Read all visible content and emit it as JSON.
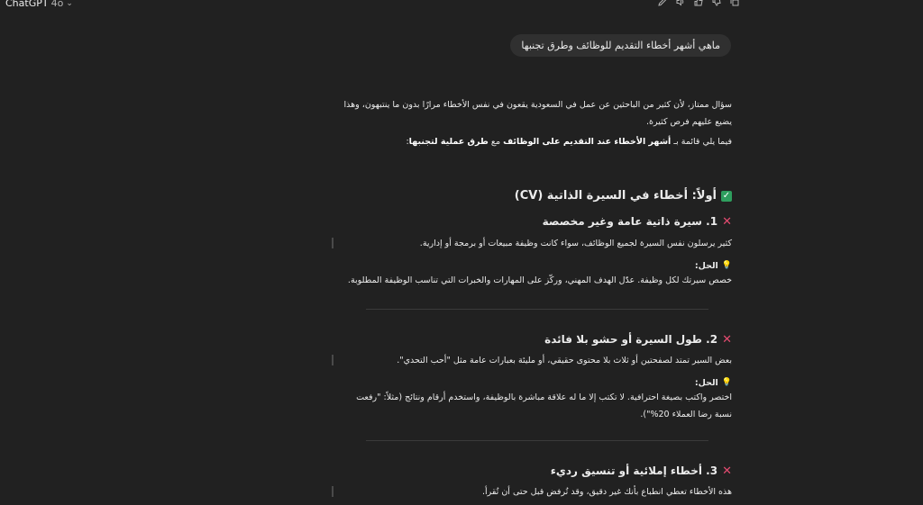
{
  "app": {
    "name": "ChatGPT",
    "model_version": "4o"
  },
  "toolbar_icons": [
    "edit-icon",
    "speaker-icon",
    "thumbs-up-icon",
    "thumbs-down-icon",
    "copy-icon"
  ],
  "user_message": "ماهي  أشهر أخطاء التقديم للوظائف  وطرق تجنبها",
  "answer": {
    "intro": "سؤال ممتاز، لأن كثير من الباحثين عن عمل في السعودية يقعون في نفس الأخطاء مرارًا بدون ما ينتبهون، وهذا يضيع عليهم فرص كثيرة.",
    "list_intro_pre": "فيما يلي قائمة بـ ",
    "list_intro_bold1": "أشهر الأخطاء عند التقديم على الوظائف",
    "list_intro_mid": " مع ",
    "list_intro_bold2": "طرق عملية لتجنبها",
    "list_intro_end": ":",
    "section_title": "أولاً: أخطاء في السيرة الذاتية (CV)",
    "solution_label": "الحل:",
    "items": [
      {
        "title": "1. سيرة ذاتية عامة وغير مخصصة",
        "problem": "كثير يرسلون نفس السيرة لجميع الوظائف، سواء كانت وظيفة مبيعات أو برمجة أو إدارية.",
        "solution": "خصص سيرتك لكل وظيفة. عدّل الهدف المهني، وركّز على المهارات والخبرات التي تناسب الوظيفة المطلوبة."
      },
      {
        "title": "2. طول السيرة أو حشو بلا فائدة",
        "problem": "بعض السير تمتد لصفحتين أو ثلاث بلا محتوى حقيقي، أو مليئة بعبارات عامة مثل \"أحب التحدي\".",
        "solution": "اختصر واكتب بصيغة احترافية. لا تكتب إلا ما له علاقة مباشرة بالوظيفة، واستخدم أرقام ونتائج (مثلاً: \"رفعت نسبة رضا العملاء 20%\")."
      },
      {
        "title": "3. أخطاء إملائية أو تنسيق رديء",
        "problem": "هذه الأخطاء تعطي انطباع بأنك غير دقيق، وقد تُرفض قبل حتى أن تُقرأ."
      }
    ]
  }
}
